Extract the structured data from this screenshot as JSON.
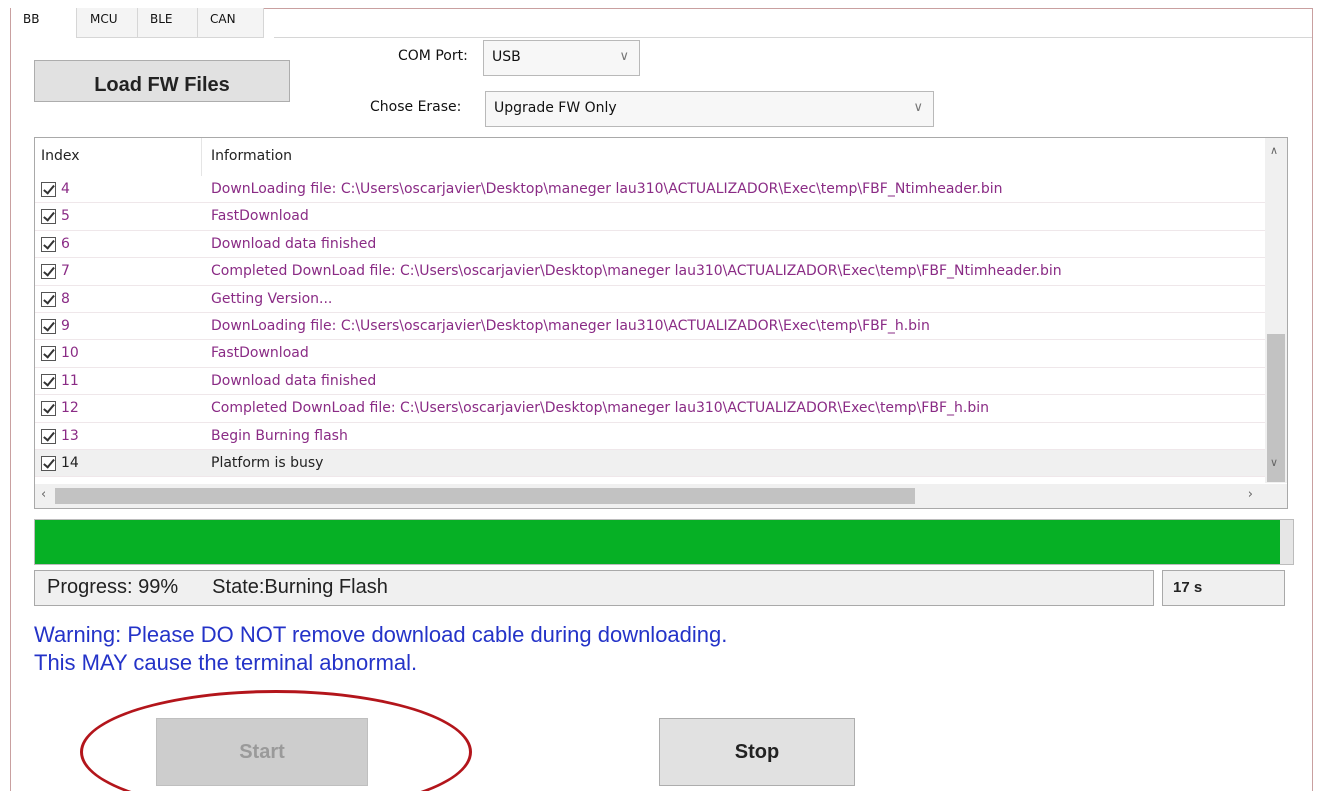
{
  "tabs": [
    {
      "label": "BB",
      "active": true
    },
    {
      "label": "MCU",
      "active": false
    },
    {
      "label": "BLE",
      "active": false
    },
    {
      "label": "CAN",
      "active": false
    }
  ],
  "load_button": "Load FW Files",
  "com_port": {
    "label": "COM Port:",
    "value": "USB"
  },
  "erase": {
    "label": "Chose Erase:",
    "value": "Upgrade FW Only"
  },
  "list": {
    "headers": {
      "index": "Index",
      "information": "Information"
    },
    "rows": [
      {
        "index": "4",
        "info": "DownLoading file: C:\\Users\\oscarjavier\\Desktop\\maneger lau310\\ACTUALIZADOR\\Exec\\temp\\FBF_Ntimheader.bin",
        "checked": true
      },
      {
        "index": "5",
        "info": "FastDownload",
        "checked": true
      },
      {
        "index": "6",
        "info": "Download data finished",
        "checked": true
      },
      {
        "index": "7",
        "info": "Completed DownLoad file: C:\\Users\\oscarjavier\\Desktop\\maneger lau310\\ACTUALIZADOR\\Exec\\temp\\FBF_Ntimheader.bin",
        "checked": true
      },
      {
        "index": "8",
        "info": "Getting Version...",
        "checked": true
      },
      {
        "index": "9",
        "info": "DownLoading file: C:\\Users\\oscarjavier\\Desktop\\maneger lau310\\ACTUALIZADOR\\Exec\\temp\\FBF_h.bin",
        "checked": true
      },
      {
        "index": "10",
        "info": "FastDownload",
        "checked": true
      },
      {
        "index": "11",
        "info": "Download data finished",
        "checked": true
      },
      {
        "index": "12",
        "info": "Completed DownLoad file: C:\\Users\\oscarjavier\\Desktop\\maneger lau310\\ACTUALIZADOR\\Exec\\temp\\FBF_h.bin",
        "checked": true
      },
      {
        "index": "13",
        "info": "Begin Burning flash",
        "checked": true
      },
      {
        "index": "14",
        "info": "Platform is busy",
        "checked": true,
        "selected": true
      }
    ]
  },
  "progress": {
    "fraction": 0.99,
    "color": "#06b025"
  },
  "status": {
    "progress_text": "Progress: 99%",
    "state_text": "State:Burning Flash"
  },
  "timer": "17 s",
  "warning": {
    "line1": "Warning: Please DO NOT remove download cable during downloading.",
    "line2": "This MAY cause the terminal abnormal."
  },
  "buttons": {
    "start": "Start",
    "stop": "Stop"
  },
  "colors": {
    "log_text": "#8a2b85",
    "warning": "#2433c8",
    "highlight_circle": "#b3151b"
  }
}
